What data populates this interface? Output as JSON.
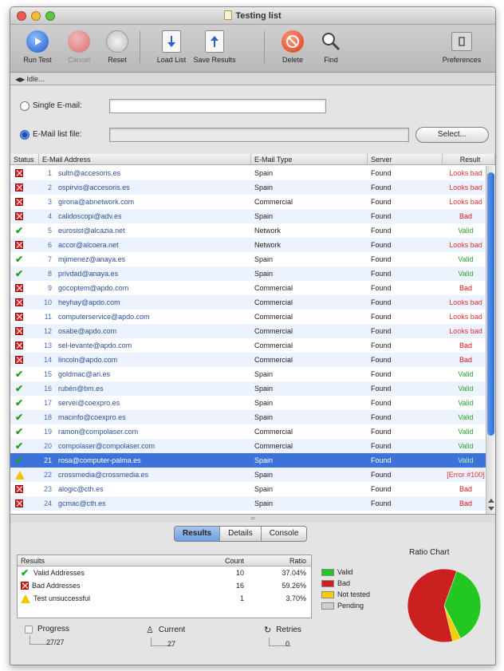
{
  "window": {
    "title": "Testing list"
  },
  "toolbar": {
    "run_test": "Run Test",
    "cancel": "Cancel",
    "reset": "Reset",
    "load_list": "Load List",
    "save_results": "Save Results",
    "delete": "Delete",
    "find": "Find",
    "preferences": "Preferences"
  },
  "status_line": "Idle...",
  "source": {
    "single_label": "Single E-mail:",
    "single_value": "",
    "list_label": "E-Mail list file:",
    "list_value": "",
    "select_button": "Select..."
  },
  "table": {
    "columns": [
      "Status",
      "E-Mail Address",
      "E-Mail Type",
      "Server",
      "Result"
    ],
    "rows": [
      {
        "status": "bad",
        "num": "1",
        "email": "sultn@accesoris.es",
        "type": "Spain",
        "server": "Found",
        "result": "Looks bad",
        "rclass": "res-looks"
      },
      {
        "status": "bad",
        "num": "2",
        "email": "ospirvis@accesoris.es",
        "type": "Spain",
        "server": "Found",
        "result": "Looks bad",
        "rclass": "res-looks"
      },
      {
        "status": "bad",
        "num": "3",
        "email": "girona@abnetwork.com",
        "type": "Commercial",
        "server": "Found",
        "result": "Looks bad",
        "rclass": "res-looks"
      },
      {
        "status": "bad",
        "num": "4",
        "email": "calidoscopi@adv.es",
        "type": "Spain",
        "server": "Found",
        "result": "Bad",
        "rclass": "res-bad"
      },
      {
        "status": "valid",
        "num": "5",
        "email": "eurosist@alcazia.net",
        "type": "Network",
        "server": "Found",
        "result": "Valid",
        "rclass": "res-valid"
      },
      {
        "status": "bad",
        "num": "6",
        "email": "accor@alcoera.net",
        "type": "Network",
        "server": "Found",
        "result": "Looks bad",
        "rclass": "res-looks"
      },
      {
        "status": "valid",
        "num": "7",
        "email": "mjimenez@anaya.es",
        "type": "Spain",
        "server": "Found",
        "result": "Valid",
        "rclass": "res-valid"
      },
      {
        "status": "valid",
        "num": "8",
        "email": "privdad@anaya.es",
        "type": "Spain",
        "server": "Found",
        "result": "Valid",
        "rclass": "res-valid"
      },
      {
        "status": "bad",
        "num": "9",
        "email": "gocoptem@apdo.com",
        "type": "Commercial",
        "server": "Found",
        "result": "Bad",
        "rclass": "res-bad"
      },
      {
        "status": "bad",
        "num": "10",
        "email": "heyhay@apdo.com",
        "type": "Commercial",
        "server": "Found",
        "result": "Looks bad",
        "rclass": "res-looks"
      },
      {
        "status": "bad",
        "num": "11",
        "email": "computerservice@apdo.com",
        "type": "Commercial",
        "server": "Found",
        "result": "Looks bad",
        "rclass": "res-looks"
      },
      {
        "status": "bad",
        "num": "12",
        "email": "osabe@apdo.com",
        "type": "Commercial",
        "server": "Found",
        "result": "Looks bad",
        "rclass": "res-looks"
      },
      {
        "status": "bad",
        "num": "13",
        "email": "sel-levante@apdo.com",
        "type": "Commercial",
        "server": "Found",
        "result": "Bad",
        "rclass": "res-bad"
      },
      {
        "status": "bad",
        "num": "14",
        "email": "lincoln@apdo.com",
        "type": "Commercial",
        "server": "Found",
        "result": "Bad",
        "rclass": "res-bad"
      },
      {
        "status": "valid",
        "num": "15",
        "email": "goldmac@ari.es",
        "type": "Spain",
        "server": "Found",
        "result": "Valid",
        "rclass": "res-valid"
      },
      {
        "status": "valid",
        "num": "16",
        "email": "rubén@bm.es",
        "type": "Spain",
        "server": "Found",
        "result": "Valid",
        "rclass": "res-valid"
      },
      {
        "status": "valid",
        "num": "17",
        "email": "servei@coexpro.es",
        "type": "Spain",
        "server": "Found",
        "result": "Valid",
        "rclass": "res-valid"
      },
      {
        "status": "valid",
        "num": "18",
        "email": "macinfo@coexpro.es",
        "type": "Spain",
        "server": "Found",
        "result": "Valid",
        "rclass": "res-valid"
      },
      {
        "status": "valid",
        "num": "19",
        "email": "ramon@compolaser.com",
        "type": "Commercial",
        "server": "Found",
        "result": "Valid",
        "rclass": "res-valid"
      },
      {
        "status": "valid",
        "num": "20",
        "email": "compolaser@compolaser.com",
        "type": "Commercial",
        "server": "Found",
        "result": "Valid",
        "rclass": "res-valid"
      },
      {
        "status": "valid",
        "num": "21",
        "email": "rosa@computer-palma.es",
        "type": "Spain",
        "server": "Found",
        "result": "Valid",
        "rclass": "res-valid",
        "selected": true
      },
      {
        "status": "warn",
        "num": "22",
        "email": "crossmedia@crossmedia.es",
        "type": "Spain",
        "server": "Found",
        "result": "[Error #100]",
        "rclass": "res-error"
      },
      {
        "status": "bad",
        "num": "23",
        "email": "alogic@cth.es",
        "type": "Spain",
        "server": "Found",
        "result": "Bad",
        "rclass": "res-bad"
      },
      {
        "status": "bad",
        "num": "24",
        "email": "gcmac@cth.es",
        "type": "Spain",
        "server": "Found",
        "result": "Bad",
        "rclass": "res-bad"
      }
    ]
  },
  "tabs": [
    "Results",
    "Details",
    "Console"
  ],
  "results": {
    "headers": [
      "Results",
      "Count",
      "Ratio"
    ],
    "rows": [
      {
        "icon": "valid",
        "name": "Valid Addresses",
        "count": "10",
        "ratio": "37.04%"
      },
      {
        "icon": "bad",
        "name": "Bad Addresses",
        "count": "16",
        "ratio": "59.26%"
      },
      {
        "icon": "warn",
        "name": "Test unsuccessful",
        "count": "1",
        "ratio": "3.70%"
      }
    ]
  },
  "legend": [
    {
      "label": "Valid",
      "color": "#22c722"
    },
    {
      "label": "Bad",
      "color": "#cc1f1f"
    },
    {
      "label": "Not tested",
      "color": "#f2d000"
    },
    {
      "label": "Pending",
      "color": "#cfcfcf"
    }
  ],
  "chart_data": {
    "type": "pie",
    "title": "Ratio Chart",
    "categories": [
      "Valid",
      "Bad",
      "Not tested",
      "Pending"
    ],
    "values": [
      37.04,
      59.26,
      3.7,
      0
    ],
    "colors": [
      "#22c722",
      "#cc1f1f",
      "#f2d000",
      "#cfcfcf"
    ]
  },
  "progress": {
    "label": "Progress",
    "value": "27/27"
  },
  "current": {
    "label": "Current",
    "value": "27"
  },
  "retries": {
    "label": "Retries",
    "value": "0"
  }
}
